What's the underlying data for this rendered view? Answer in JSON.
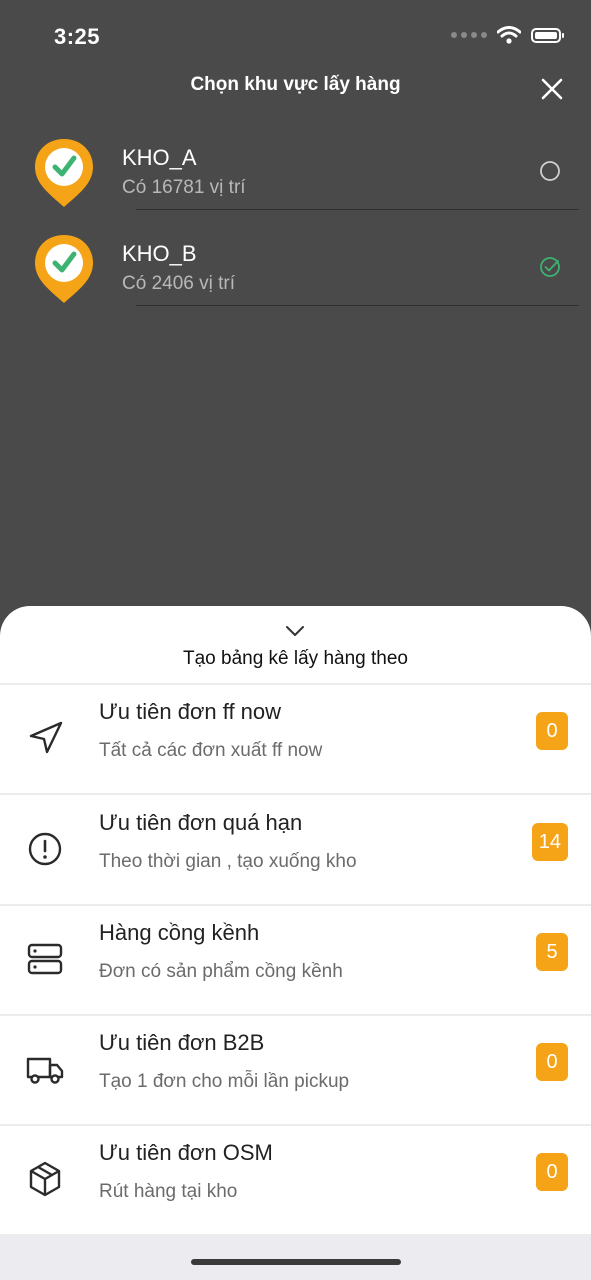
{
  "status": {
    "time": "3:25"
  },
  "header": {
    "title": "Chọn khu vực lấy hàng"
  },
  "zones": [
    {
      "name": "KHO_A",
      "subtitle": "Có 16781 vị trí",
      "selected": false
    },
    {
      "name": "KHO_B",
      "subtitle": "Có 2406 vị trí",
      "selected": true
    }
  ],
  "sheet": {
    "title": "Tạo bảng kê lấy hàng theo",
    "options": [
      {
        "icon": "navigation-arrow-icon",
        "title": "Ưu tiên đơn ff now",
        "subtitle": "Tất cả các đơn xuất ff now",
        "count": "0"
      },
      {
        "icon": "alert-circle-icon",
        "title": "Ưu tiên đơn quá hạn",
        "subtitle": "Theo thời gian , tạo xuống kho",
        "count": "14"
      },
      {
        "icon": "server-icon",
        "title": "Hàng cồng kềnh",
        "subtitle": "Đơn có sản phẩm cồng kềnh",
        "count": "5"
      },
      {
        "icon": "truck-icon",
        "title": "Ưu tiên đơn B2B",
        "subtitle": "Tạo 1 đơn cho mỗi lần pickup",
        "count": "0"
      },
      {
        "icon": "package-icon",
        "title": "Ưu tiên đơn OSM",
        "subtitle": "Rút hàng tại kho",
        "count": "0"
      }
    ]
  },
  "colors": {
    "accent": "#f5a317",
    "selected": "#3cb371",
    "overlay": "#4a4a4a"
  }
}
